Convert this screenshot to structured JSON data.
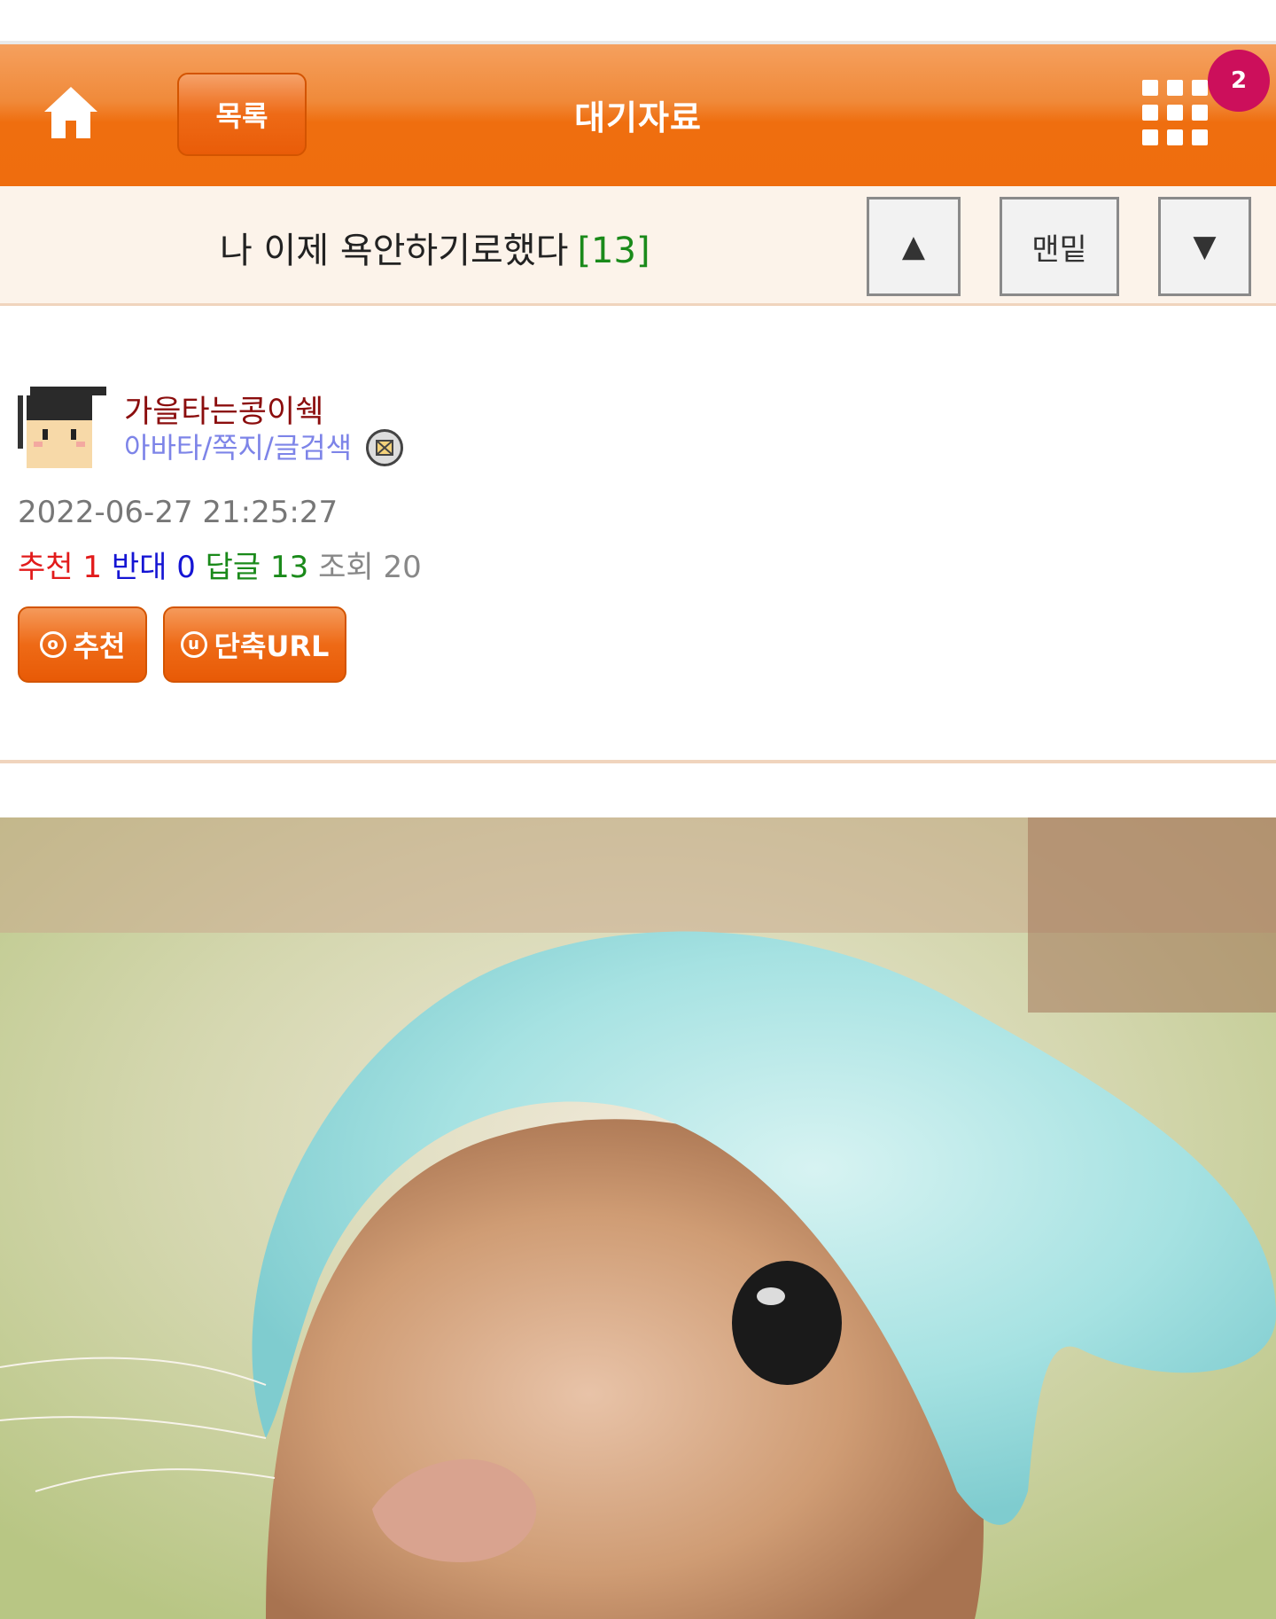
{
  "header": {
    "list_label": "목록",
    "title": "대기자료",
    "notification_count": "2"
  },
  "post": {
    "title": "나 이제 욕안하기로했다",
    "reply_count_label": "[13]",
    "nav_bottom_label": "맨밑",
    "nav_up_symbol": "▲",
    "nav_down_symbol": "▼"
  },
  "author": {
    "nickname": "가을타는콩이쉑",
    "links": "아바타/쪽지/글검색"
  },
  "meta": {
    "datetime": "2022-06-27 21:25:27",
    "recommend_label": "추천",
    "recommend_value": "1",
    "oppose_label": "반대",
    "oppose_value": "0",
    "reply_label": "답글",
    "reply_value": "13",
    "view_label": "조회",
    "view_value": "20"
  },
  "actions": {
    "recommend_label": "추천",
    "recommend_icon_char": "o",
    "shorturl_label": "단축URL",
    "shorturl_icon_char": "u"
  },
  "colors": {
    "brand_orange": "#ef6d0e",
    "badge": "#cc0f5b",
    "nickname": "#8b0d0d",
    "links": "#7d84e8",
    "recommend": "#e21b1b",
    "oppose": "#1515d4",
    "reply": "#1a8a1a"
  }
}
